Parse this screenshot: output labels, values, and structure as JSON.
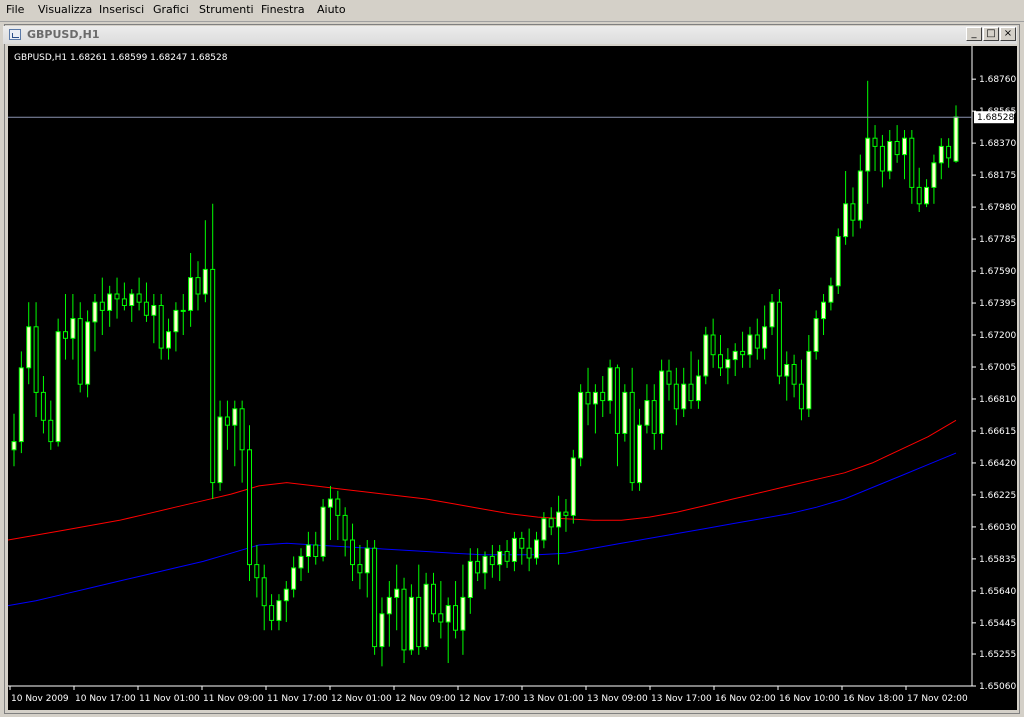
{
  "menu": [
    "File",
    "Visualizza",
    "Inserisci",
    "Grafici",
    "Strumenti",
    "Finestra",
    "Aiuto"
  ],
  "window": {
    "title": "GBPUSD,H1",
    "minimize_glyph": "_",
    "maximize_glyph": "□",
    "close_glyph": "×"
  },
  "chart_header": "GBPUSD,H1  1.68261 1.68599 1.68247 1.68528",
  "colors": {
    "background": "#000000",
    "axis": "#ffffff",
    "candle_up": "#ffffcc",
    "wick": "#00ff00",
    "ma_red": "#ff0000",
    "ma_blue": "#0000ff",
    "price_line": "#8a93b0"
  },
  "chart_data": {
    "type": "candlestick",
    "symbol": "GBPUSD",
    "timeframe": "H1",
    "ylim": [
      1.6506,
      1.6895
    ],
    "current_price": "1.68528",
    "y_ticks": [
      "1.68760",
      "1.68565",
      "1.68370",
      "1.68175",
      "1.67980",
      "1.67785",
      "1.67590",
      "1.67395",
      "1.67200",
      "1.67005",
      "1.66810",
      "1.66615",
      "1.66420",
      "1.66225",
      "1.66030",
      "1.65835",
      "1.65640",
      "1.65445",
      "1.65255",
      "1.65060"
    ],
    "x_ticks": [
      "10 Nov 2009",
      "10 Nov 17:00",
      "11 Nov 01:00",
      "11 Nov 09:00",
      "11 Nov 17:00",
      "12 Nov 01:00",
      "12 Nov 09:00",
      "12 Nov 17:00",
      "13 Nov 01:00",
      "13 Nov 09:00",
      "13 Nov 17:00",
      "16 Nov 02:00",
      "16 Nov 10:00",
      "16 Nov 18:00",
      "17 Nov 02:00"
    ],
    "ohlc": [
      [
        1.665,
        1.6672,
        1.664,
        1.6655
      ],
      [
        1.6655,
        1.671,
        1.6648,
        1.67
      ],
      [
        1.67,
        1.674,
        1.669,
        1.6725
      ],
      [
        1.6725,
        1.674,
        1.667,
        1.6685
      ],
      [
        1.6685,
        1.6695,
        1.666,
        1.6668
      ],
      [
        1.6668,
        1.668,
        1.665,
        1.6655
      ],
      [
        1.6655,
        1.673,
        1.6652,
        1.6722
      ],
      [
        1.6722,
        1.6745,
        1.6705,
        1.6718
      ],
      [
        1.6718,
        1.6745,
        1.6705,
        1.673
      ],
      [
        1.673,
        1.674,
        1.6685,
        1.669
      ],
      [
        1.669,
        1.6735,
        1.6682,
        1.6728
      ],
      [
        1.6728,
        1.6745,
        1.671,
        1.674
      ],
      [
        1.674,
        1.6755,
        1.672,
        1.6735
      ],
      [
        1.6735,
        1.675,
        1.6725,
        1.6745
      ],
      [
        1.6745,
        1.6755,
        1.673,
        1.6742
      ],
      [
        1.6742,
        1.6752,
        1.6735,
        1.6738
      ],
      [
        1.6738,
        1.6748,
        1.6728,
        1.6745
      ],
      [
        1.6745,
        1.6755,
        1.6735,
        1.674
      ],
      [
        1.674,
        1.6752,
        1.6728,
        1.6732
      ],
      [
        1.6732,
        1.6745,
        1.6715,
        1.6738
      ],
      [
        1.6738,
        1.6745,
        1.6705,
        1.6712
      ],
      [
        1.6712,
        1.673,
        1.6705,
        1.6722
      ],
      [
        1.6722,
        1.674,
        1.671,
        1.6735
      ],
      [
        1.6735,
        1.6745,
        1.672,
        1.6735
      ],
      [
        1.6735,
        1.677,
        1.6725,
        1.6755
      ],
      [
        1.6755,
        1.6765,
        1.6735,
        1.6745
      ],
      [
        1.6745,
        1.679,
        1.674,
        1.676
      ],
      [
        1.676,
        1.68,
        1.662,
        1.663
      ],
      [
        1.663,
        1.668,
        1.6625,
        1.667
      ],
      [
        1.667,
        1.668,
        1.665,
        1.6665
      ],
      [
        1.6665,
        1.668,
        1.664,
        1.6675
      ],
      [
        1.6675,
        1.668,
        1.663,
        1.665
      ],
      [
        1.665,
        1.6665,
        1.657,
        1.658
      ],
      [
        1.658,
        1.6592,
        1.656,
        1.6572
      ],
      [
        1.6572,
        1.658,
        1.654,
        1.6555
      ],
      [
        1.6555,
        1.6562,
        1.654,
        1.6546
      ],
      [
        1.6546,
        1.6562,
        1.654,
        1.6558
      ],
      [
        1.6558,
        1.657,
        1.6545,
        1.6565
      ],
      [
        1.6565,
        1.6585,
        1.656,
        1.6578
      ],
      [
        1.6578,
        1.659,
        1.657,
        1.6585
      ],
      [
        1.6585,
        1.66,
        1.6575,
        1.6592
      ],
      [
        1.6592,
        1.66,
        1.658,
        1.6585
      ],
      [
        1.6585,
        1.662,
        1.6582,
        1.6615
      ],
      [
        1.6615,
        1.6628,
        1.6595,
        1.662
      ],
      [
        1.662,
        1.6625,
        1.6595,
        1.661
      ],
      [
        1.661,
        1.6615,
        1.6585,
        1.6595
      ],
      [
        1.6595,
        1.6605,
        1.657,
        1.658
      ],
      [
        1.658,
        1.6592,
        1.6565,
        1.6575
      ],
      [
        1.6575,
        1.6595,
        1.656,
        1.659
      ],
      [
        1.659,
        1.6595,
        1.6525,
        1.653
      ],
      [
        1.653,
        1.656,
        1.6518,
        1.655
      ],
      [
        1.655,
        1.657,
        1.653,
        1.656
      ],
      [
        1.656,
        1.658,
        1.654,
        1.6565
      ],
      [
        1.6565,
        1.6572,
        1.652,
        1.6528
      ],
      [
        1.6528,
        1.6568,
        1.6525,
        1.656
      ],
      [
        1.656,
        1.658,
        1.6525,
        1.653
      ],
      [
        1.653,
        1.6575,
        1.6528,
        1.6568
      ],
      [
        1.6568,
        1.6575,
        1.6545,
        1.655
      ],
      [
        1.655,
        1.657,
        1.6535,
        1.6545
      ],
      [
        1.6545,
        1.656,
        1.652,
        1.6555
      ],
      [
        1.6555,
        1.657,
        1.6535,
        1.654
      ],
      [
        1.654,
        1.658,
        1.6525,
        1.656
      ],
      [
        1.656,
        1.659,
        1.655,
        1.6582
      ],
      [
        1.6582,
        1.659,
        1.657,
        1.6575
      ],
      [
        1.6575,
        1.6588,
        1.6565,
        1.6585
      ],
      [
        1.6585,
        1.6592,
        1.6572,
        1.658
      ],
      [
        1.658,
        1.6592,
        1.657,
        1.6588
      ],
      [
        1.6588,
        1.6595,
        1.6578,
        1.6582
      ],
      [
        1.6582,
        1.66,
        1.6576,
        1.6596
      ],
      [
        1.6596,
        1.66,
        1.658,
        1.659
      ],
      [
        1.659,
        1.6602,
        1.6576,
        1.6584
      ],
      [
        1.6584,
        1.66,
        1.658,
        1.6595
      ],
      [
        1.6595,
        1.6612,
        1.659,
        1.6608
      ],
      [
        1.6608,
        1.6615,
        1.6598,
        1.6603
      ],
      [
        1.6603,
        1.6622,
        1.658,
        1.6612
      ],
      [
        1.6612,
        1.662,
        1.66,
        1.661
      ],
      [
        1.661,
        1.665,
        1.6605,
        1.6645
      ],
      [
        1.6645,
        1.669,
        1.664,
        1.6685
      ],
      [
        1.6685,
        1.67,
        1.6665,
        1.6678
      ],
      [
        1.6678,
        1.669,
        1.666,
        1.6685
      ],
      [
        1.6685,
        1.6695,
        1.667,
        1.668
      ],
      [
        1.668,
        1.6705,
        1.6672,
        1.67
      ],
      [
        1.67,
        1.6702,
        1.664,
        1.666
      ],
      [
        1.666,
        1.669,
        1.6655,
        1.6685
      ],
      [
        1.6685,
        1.67,
        1.6625,
        1.663
      ],
      [
        1.663,
        1.6675,
        1.6625,
        1.6665
      ],
      [
        1.6665,
        1.669,
        1.666,
        1.668
      ],
      [
        1.668,
        1.669,
        1.665,
        1.666
      ],
      [
        1.666,
        1.6705,
        1.665,
        1.6698
      ],
      [
        1.6698,
        1.6705,
        1.668,
        1.669
      ],
      [
        1.669,
        1.67,
        1.6665,
        1.6675
      ],
      [
        1.6675,
        1.67,
        1.667,
        1.669
      ],
      [
        1.669,
        1.671,
        1.6675,
        1.668
      ],
      [
        1.668,
        1.6705,
        1.6675,
        1.6695
      ],
      [
        1.6695,
        1.6725,
        1.669,
        1.672
      ],
      [
        1.672,
        1.673,
        1.67,
        1.6708
      ],
      [
        1.6708,
        1.672,
        1.6695,
        1.67
      ],
      [
        1.67,
        1.6712,
        1.669,
        1.6705
      ],
      [
        1.6705,
        1.6715,
        1.6695,
        1.671
      ],
      [
        1.671,
        1.6722,
        1.67,
        1.6708
      ],
      [
        1.6708,
        1.6725,
        1.67,
        1.672
      ],
      [
        1.672,
        1.673,
        1.6705,
        1.6712
      ],
      [
        1.6712,
        1.6738,
        1.6705,
        1.6725
      ],
      [
        1.6725,
        1.6745,
        1.672,
        1.674
      ],
      [
        1.674,
        1.6748,
        1.669,
        1.6695
      ],
      [
        1.6695,
        1.671,
        1.668,
        1.6702
      ],
      [
        1.6702,
        1.6708,
        1.6682,
        1.669
      ],
      [
        1.669,
        1.6705,
        1.6668,
        1.6675
      ],
      [
        1.6675,
        1.672,
        1.667,
        1.671
      ],
      [
        1.671,
        1.6735,
        1.6705,
        1.673
      ],
      [
        1.673,
        1.6745,
        1.672,
        1.674
      ],
      [
        1.674,
        1.6755,
        1.6735,
        1.675
      ],
      [
        1.675,
        1.6785,
        1.6745,
        1.678
      ],
      [
        1.678,
        1.682,
        1.6775,
        1.68
      ],
      [
        1.68,
        1.681,
        1.678,
        1.679
      ],
      [
        1.679,
        1.683,
        1.6785,
        1.682
      ],
      [
        1.682,
        1.6875,
        1.68,
        1.684
      ],
      [
        1.684,
        1.6848,
        1.682,
        1.6835
      ],
      [
        1.6835,
        1.6842,
        1.681,
        1.682
      ],
      [
        1.682,
        1.6845,
        1.6815,
        1.6838
      ],
      [
        1.6838,
        1.6848,
        1.6825,
        1.683
      ],
      [
        1.683,
        1.6845,
        1.6815,
        1.684
      ],
      [
        1.684,
        1.6845,
        1.68,
        1.681
      ],
      [
        1.681,
        1.6822,
        1.6795,
        1.68
      ],
      [
        1.68,
        1.6815,
        1.6798,
        1.681
      ],
      [
        1.681,
        1.683,
        1.68,
        1.6825
      ],
      [
        1.6825,
        1.684,
        1.6815,
        1.6835
      ],
      [
        1.6835,
        1.684,
        1.6822,
        1.6828
      ],
      [
        1.6826,
        1.686,
        1.6825,
        1.6853
      ]
    ],
    "ma_red": [
      1.6595,
      1.6598,
      1.6601,
      1.6604,
      1.6607,
      1.6611,
      1.6615,
      1.6619,
      1.6623,
      1.6628,
      1.663,
      1.6628,
      1.6626,
      1.6624,
      1.6622,
      1.662,
      1.6617,
      1.6614,
      1.6611,
      1.6609,
      1.6608,
      1.6607,
      1.6607,
      1.6609,
      1.6612,
      1.6616,
      1.662,
      1.6624,
      1.6628,
      1.6632,
      1.6636,
      1.6642,
      1.665,
      1.6658,
      1.6668
    ],
    "ma_blue": [
      1.6555,
      1.6558,
      1.6562,
      1.6566,
      1.657,
      1.6574,
      1.6578,
      1.6582,
      1.6587,
      1.6592,
      1.6593,
      1.6592,
      1.6591,
      1.659,
      1.6589,
      1.6588,
      1.6587,
      1.6586,
      1.6586,
      1.6586,
      1.6587,
      1.659,
      1.6593,
      1.6596,
      1.6599,
      1.6602,
      1.6605,
      1.6608,
      1.6611,
      1.6615,
      1.662,
      1.6627,
      1.6634,
      1.6641,
      1.6648
    ]
  }
}
